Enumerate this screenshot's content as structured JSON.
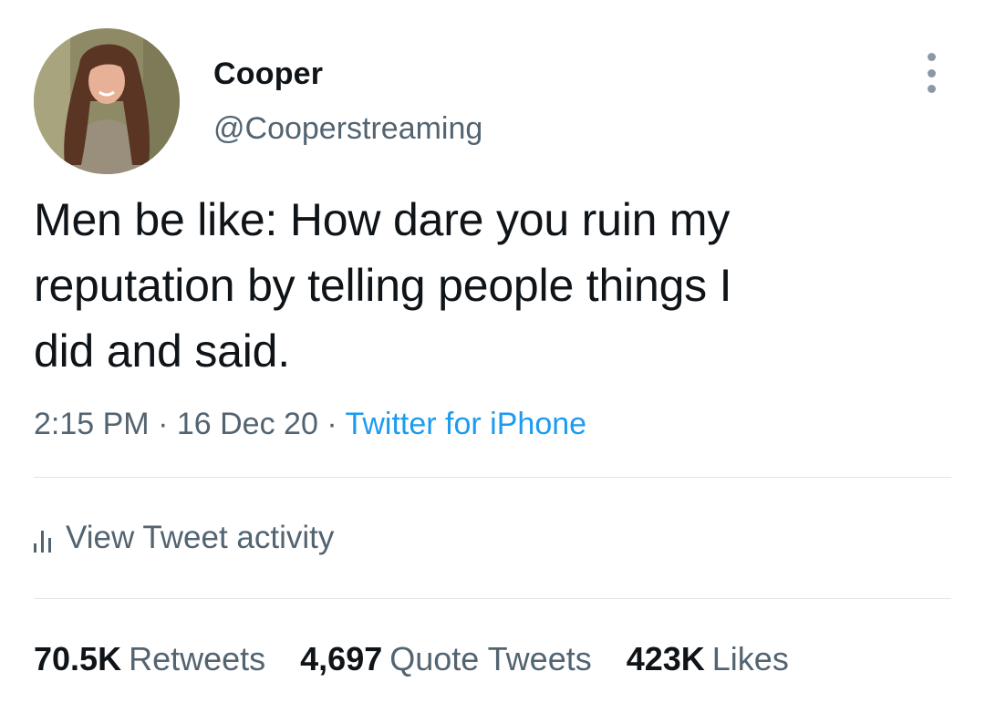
{
  "author": {
    "display_name": "Cooper",
    "handle": "@Cooperstreaming"
  },
  "tweet": {
    "text_line1": "Men be like: How dare you ruin my",
    "text_line2": "reputation by telling people things I",
    "text_line3": "did and said."
  },
  "meta": {
    "time": "2:15 PM",
    "date": "16 Dec 20",
    "source": "Twitter for iPhone",
    "separator": "·"
  },
  "activity": {
    "label": "View Tweet activity"
  },
  "stats": {
    "retweets_count": "70.5K",
    "retweets_label": "Retweets",
    "quotes_count": "4,697",
    "quotes_label": "Quote Tweets",
    "likes_count": "423K",
    "likes_label": "Likes"
  },
  "colors": {
    "text": "#0f1419",
    "secondary": "#536471",
    "link": "#1d9bf0",
    "divider": "#e1e6ea"
  },
  "icons": {
    "more": "more-vertical-icon",
    "activity": "bar-chart-icon"
  }
}
